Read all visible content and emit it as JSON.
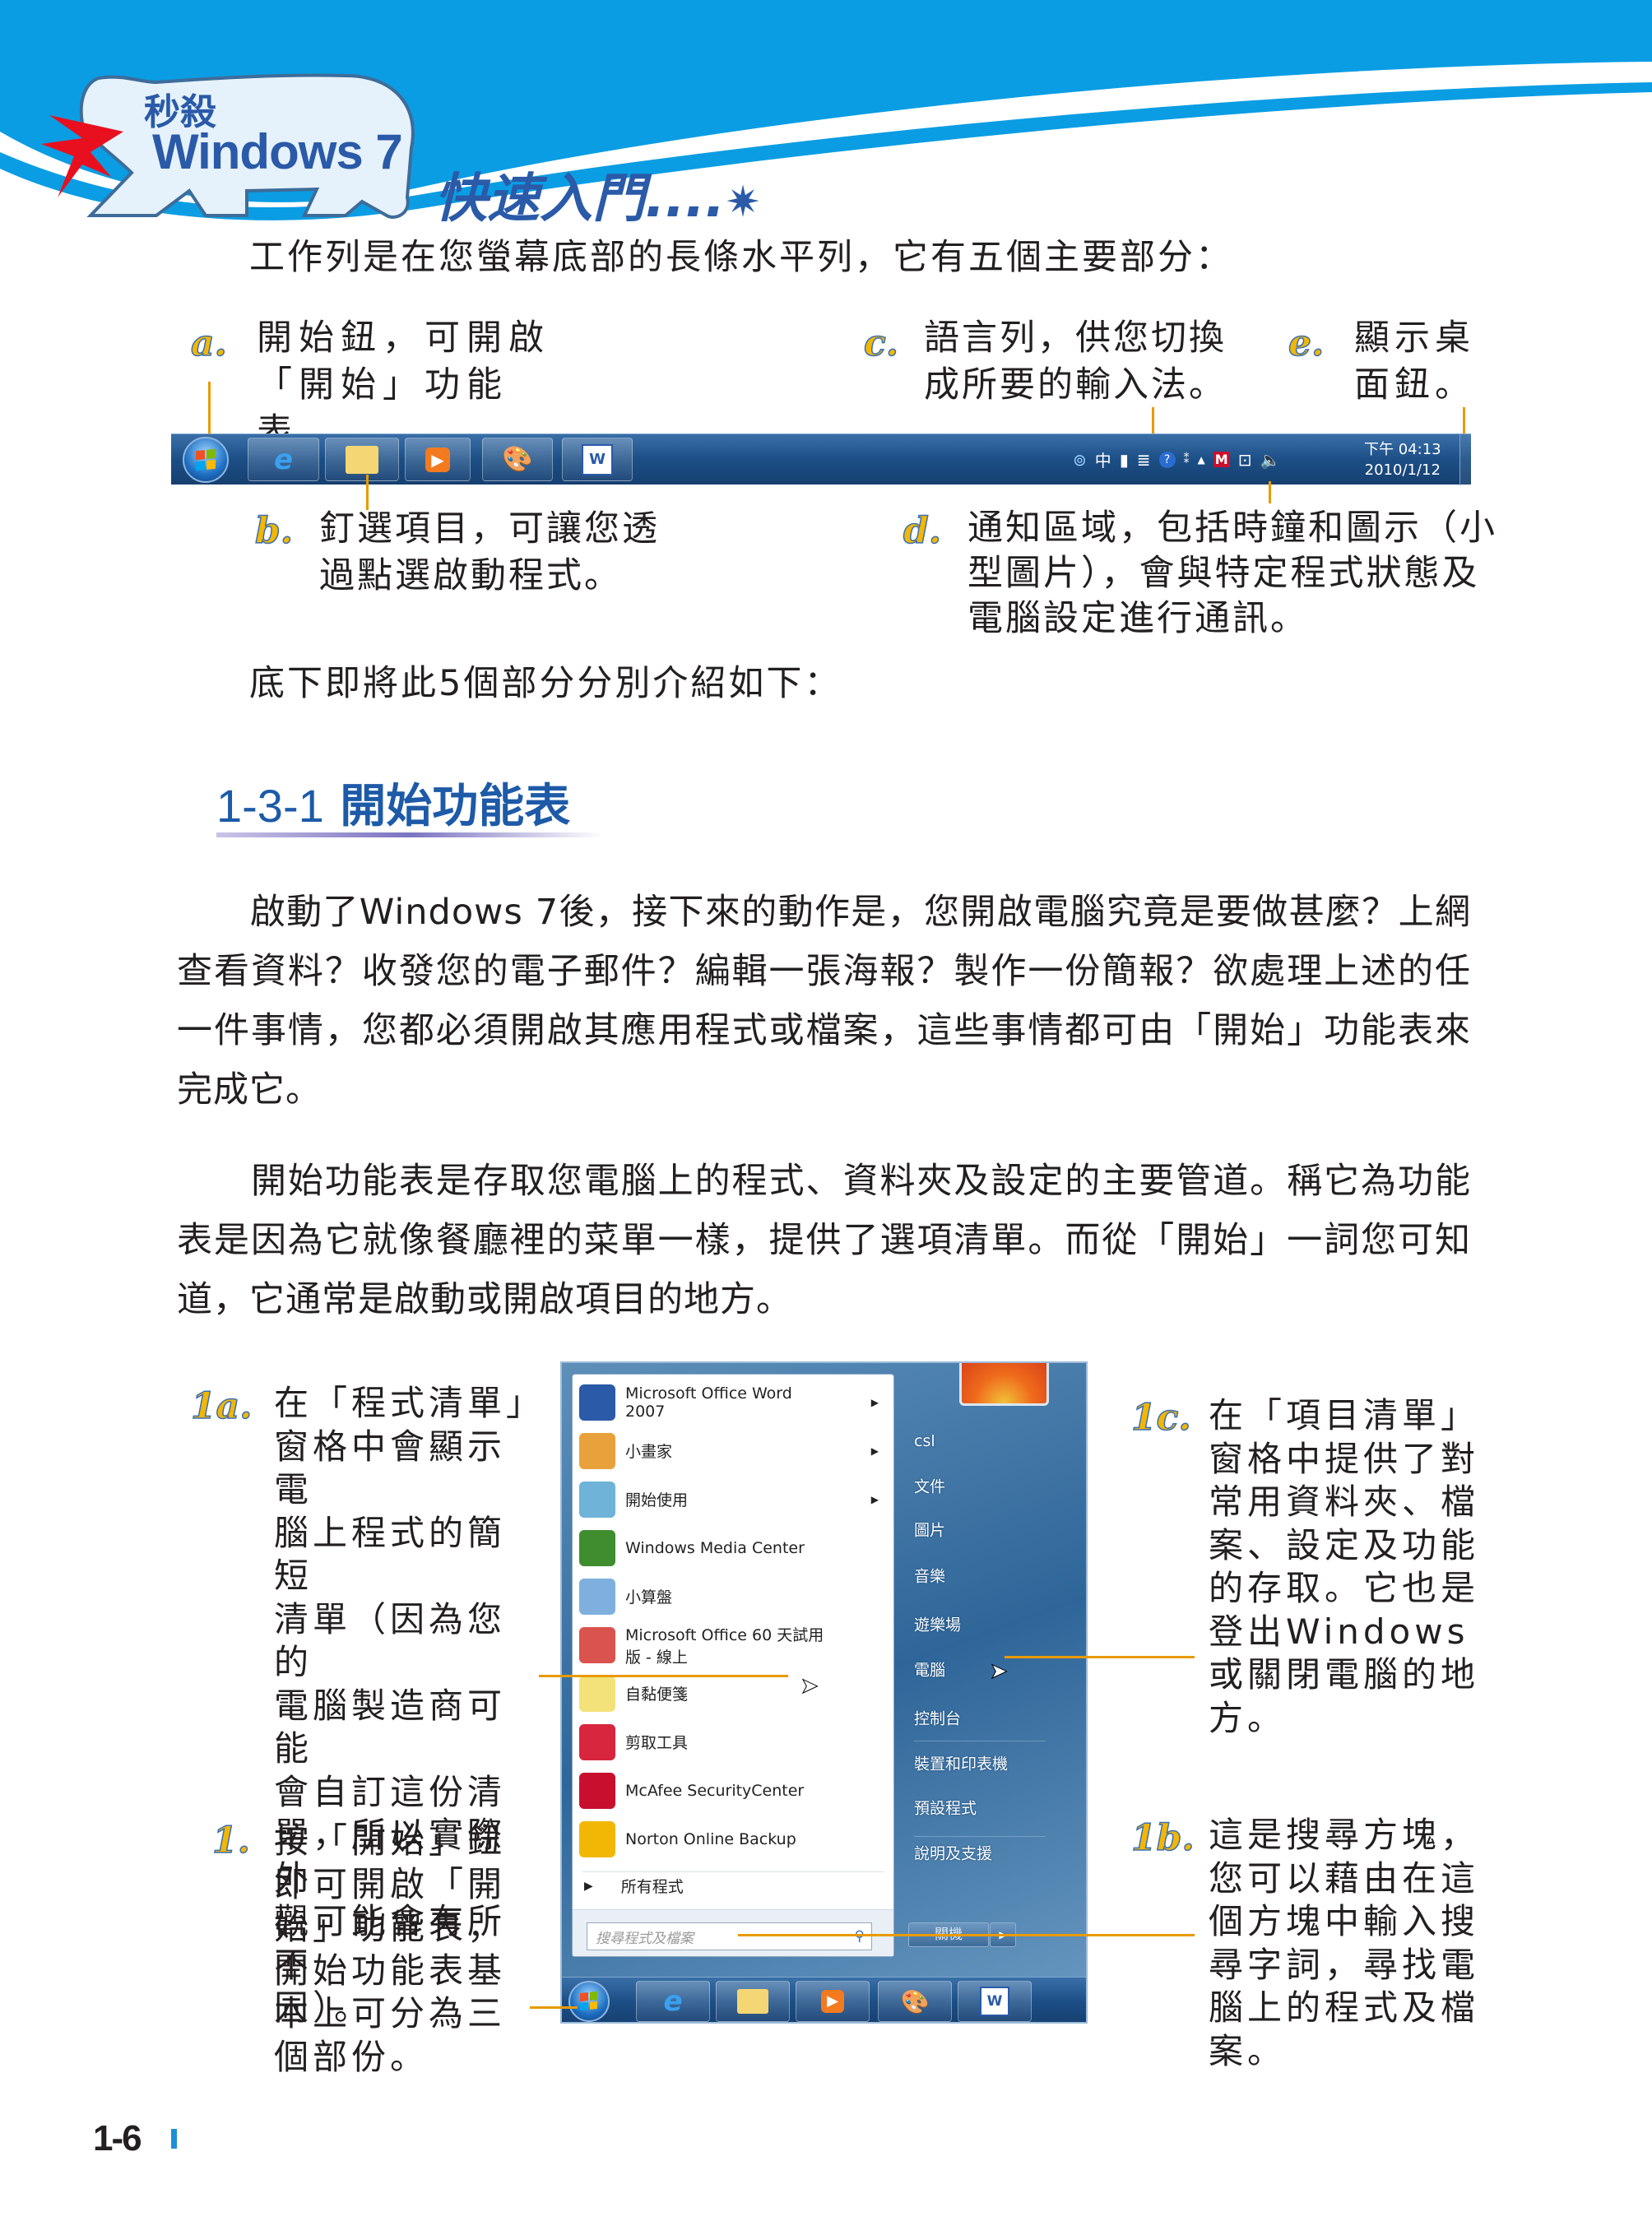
{
  "header": {
    "badge_top": "秒殺",
    "badge_main": "Windows 7",
    "series_title": "快速入門....",
    "colors": {
      "band": "#0a9de3",
      "title": "#2a5aa8",
      "callout_line": "#e89a00",
      "label": "#f2b705"
    }
  },
  "intro": "工作列是在您螢幕底部的長條水平列，它有五個主要部分：",
  "callouts_top": {
    "a": {
      "label": "a.",
      "lines": [
        "開始鈕，可開啟",
        "「開始」功能表。"
      ]
    },
    "c": {
      "label": "c.",
      "lines": [
        "語言列，供您切換",
        "成所要的輸入法。"
      ]
    },
    "e": {
      "label": "e.",
      "lines": [
        "顯示桌",
        "面鈕。"
      ]
    },
    "b": {
      "label": "b.",
      "lines": [
        "釘選項目，可讓您透",
        "過點選啟動程式。"
      ]
    },
    "d": {
      "label": "d.",
      "lines": [
        "通知區域，包括時鐘和圖示（小",
        "型圖片），會與特定程式狀態及",
        "電腦設定進行通訊。"
      ]
    }
  },
  "taskbar": {
    "pinned_icons": [
      "start-orb",
      "internet-explorer-icon",
      "file-explorer-icon",
      "media-player-icon",
      "paint-icon",
      "word-icon"
    ],
    "tray_icons": [
      "ime-icon",
      "chinese-input-icon",
      "fullwidth-icon",
      "ime-tools-icon",
      "help-icon",
      "language-options-icon",
      "show-hidden-icons",
      "mcafee-icon",
      "network-icon",
      "volume-icon"
    ],
    "tray_text": {
      "ime": "中"
    },
    "time": "下午 04:13",
    "date": "2010/1/12"
  },
  "transition": "底下即將此5個部分分別介紹如下：",
  "section": {
    "number": "1-3-1",
    "title": "開始功能表"
  },
  "paragraphs": [
    [
      "　　啟動了Windows 7後，接下來的動作是，您開啟電腦究竟是要做甚麼？上網查看資料？收發您的電子郵件？編輯一張海報？製作一份簡報？欲處理上述的任一件事情，您都必須開啟其應用程式或檔案，這些事情都可由「開始」功能表來完成它。"
    ],
    [
      "　　開始功能表是存取您電腦上的程式、資料夾及設定的主要管道。稱它為功能表是因為它就像餐廳裡的菜單一樣，提供了選項清單。而從「開始」一詞您可知道，它通常是啟動或開啟項目的地方。"
    ]
  ],
  "start_menu": {
    "programs": [
      {
        "label": "Microsoft Office Word 2007",
        "icon": "word-icon",
        "submenu": true
      },
      {
        "label": "小畫家",
        "icon": "paint-icon",
        "submenu": true
      },
      {
        "label": "開始使用",
        "icon": "getting-started-icon",
        "submenu": true
      },
      {
        "label": "Windows Media Center",
        "icon": "media-center-icon",
        "submenu": false
      },
      {
        "label": "小算盤",
        "icon": "calculator-icon",
        "submenu": false
      },
      {
        "label": "Microsoft Office 60 天試用版 - 線上",
        "icon": "office-trial-icon",
        "submenu": false
      },
      {
        "label": "自黏便箋",
        "icon": "sticky-notes-icon",
        "submenu": false
      },
      {
        "label": "剪取工具",
        "icon": "snipping-tool-icon",
        "submenu": false
      },
      {
        "label": "McAfee SecurityCenter",
        "icon": "mcafee-icon",
        "submenu": false
      },
      {
        "label": "Norton Online Backup",
        "icon": "norton-icon",
        "submenu": false
      }
    ],
    "all_programs": "所有程式",
    "search_placeholder": "搜尋程式及檔案",
    "right_items": [
      "csl",
      "文件",
      "圖片",
      "音樂",
      "遊樂場",
      "電腦",
      "控制台",
      "裝置和印表機",
      "預設程式",
      "說明及支援"
    ],
    "shutdown": "關機"
  },
  "callouts_bottom": {
    "1a": {
      "label": "1a.",
      "lines": [
        "在「程式清單」",
        "窗格中會顯示電",
        "腦上程式的簡短",
        "清單（因為您的",
        "電腦製造商可能",
        "會自訂這份清",
        "單，所以實際外",
        "觀可能會有所不",
        "同）。"
      ]
    },
    "1": {
      "label": "1.",
      "lines": [
        "按「開始」鈕",
        "即可開啟「開",
        "始」功能表，",
        "開始功能表基",
        "本上可分為三",
        "個部份。"
      ]
    },
    "1c": {
      "label": "1c.",
      "lines": [
        "在「項目清單」",
        "窗格中提供了對",
        "常用資料夾、檔",
        "案、設定及功能",
        "的存取。它也是",
        "登出Windows",
        "或關閉電腦的地",
        "方。"
      ]
    },
    "1b": {
      "label": "1b.",
      "lines": [
        "這是搜尋方塊，",
        "您可以藉由在這",
        "個方塊中輸入搜",
        "尋字詞，尋找電",
        "腦上的程式及檔",
        "案。"
      ]
    }
  },
  "footer": {
    "page_number": "1-6"
  }
}
